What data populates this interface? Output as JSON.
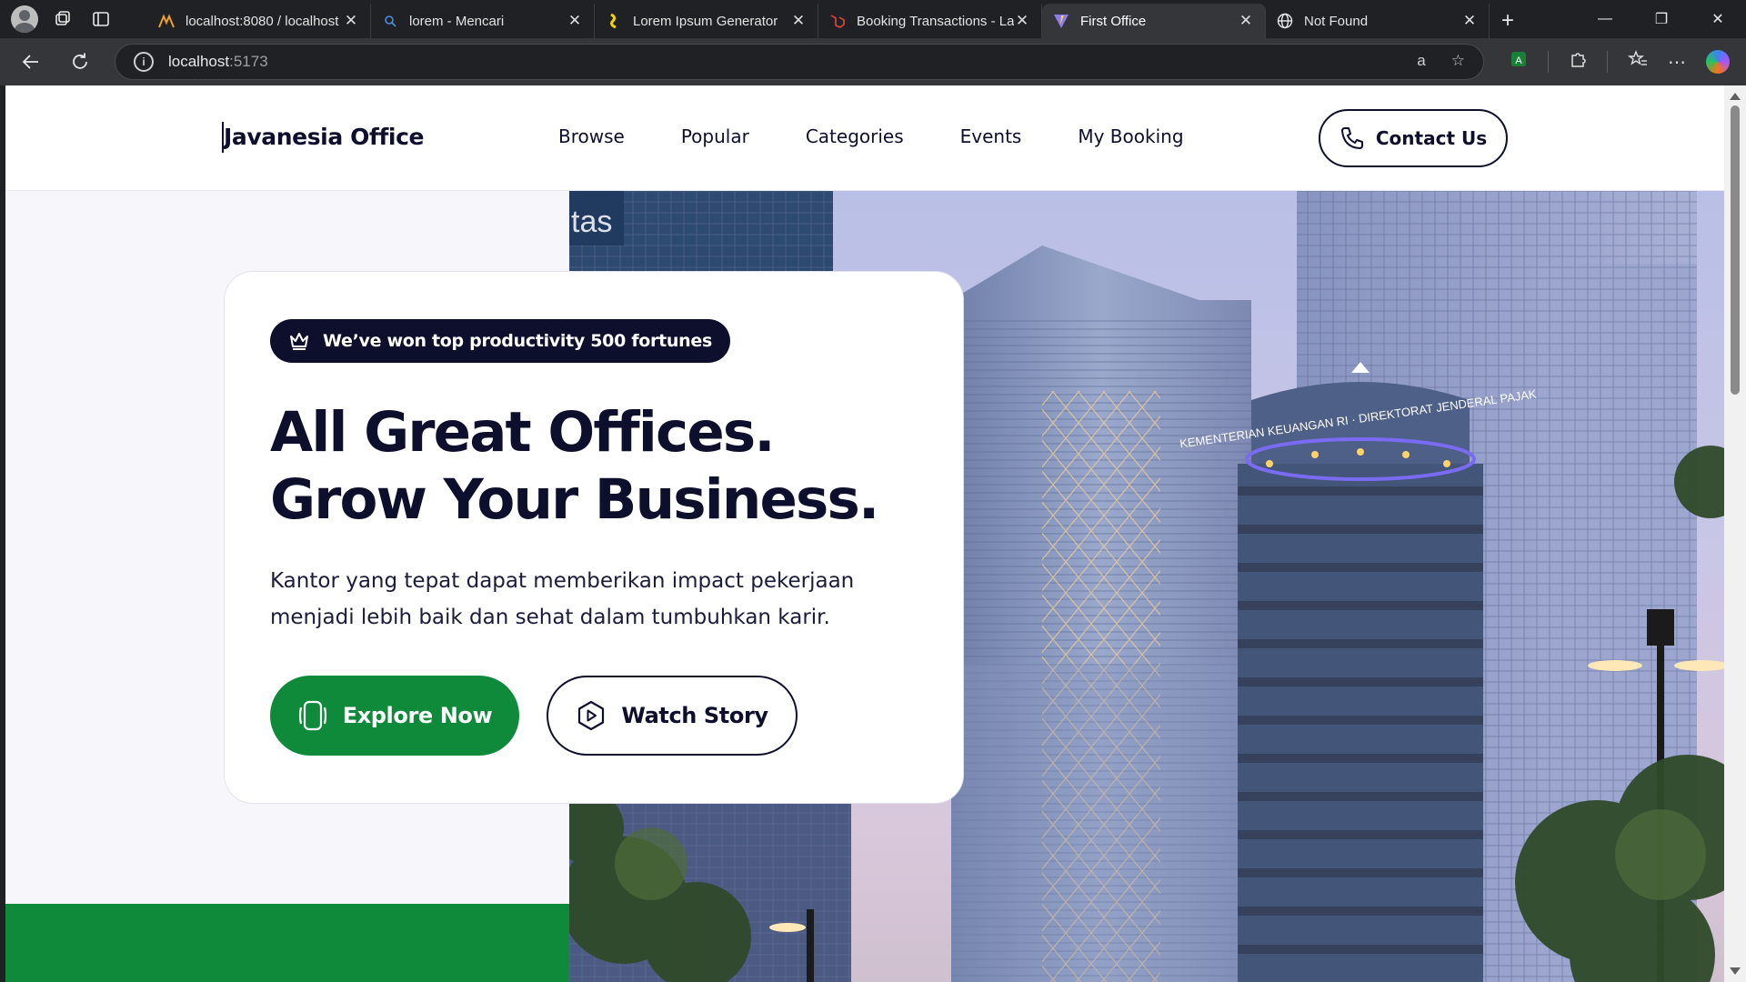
{
  "browser": {
    "tabs": [
      {
        "label": "localhost:8080 / localhost",
        "icon": "phpmyadmin-icon",
        "active": false
      },
      {
        "label": "lorem - Mencari",
        "icon": "search-icon",
        "active": false
      },
      {
        "label": "Lorem Ipsum Generator",
        "icon": "generator-icon",
        "active": false
      },
      {
        "label": "Booking Transactions - La",
        "icon": "laravel-icon",
        "active": false
      },
      {
        "label": "First Office",
        "icon": "vite-icon",
        "active": true
      },
      {
        "label": "Not Found",
        "icon": "globe-icon",
        "active": false
      }
    ],
    "address": {
      "host": "localhost",
      "port": ":5173"
    }
  },
  "site": {
    "logo": "Javanesia Office",
    "nav": [
      "Browse",
      "Popular",
      "Categories",
      "Events",
      "My Booking"
    ],
    "contact_label": "Contact Us"
  },
  "hero": {
    "badge": "We’ve won top productivity 500 fortunes",
    "headline_line1": "All Great Offices.",
    "headline_line2": "Grow Your Business.",
    "subtext_line1": "Kantor yang tepat dapat memberikan impact pekerjaan",
    "subtext_line2": "menjadi lebih baik dan sehat dalam tumbuhkan karir.",
    "explore_label": "Explore Now",
    "watch_label": "Watch Story",
    "building_sign": "KEMENTERIAN KEUANGAN RI · DIREKTORAT JENDERAL PAJAK",
    "building_sign_partial": "tas"
  },
  "colors": {
    "navy": "#0d0f2c",
    "green": "#0f8a3a",
    "hero_bg": "#f6f6fb"
  }
}
